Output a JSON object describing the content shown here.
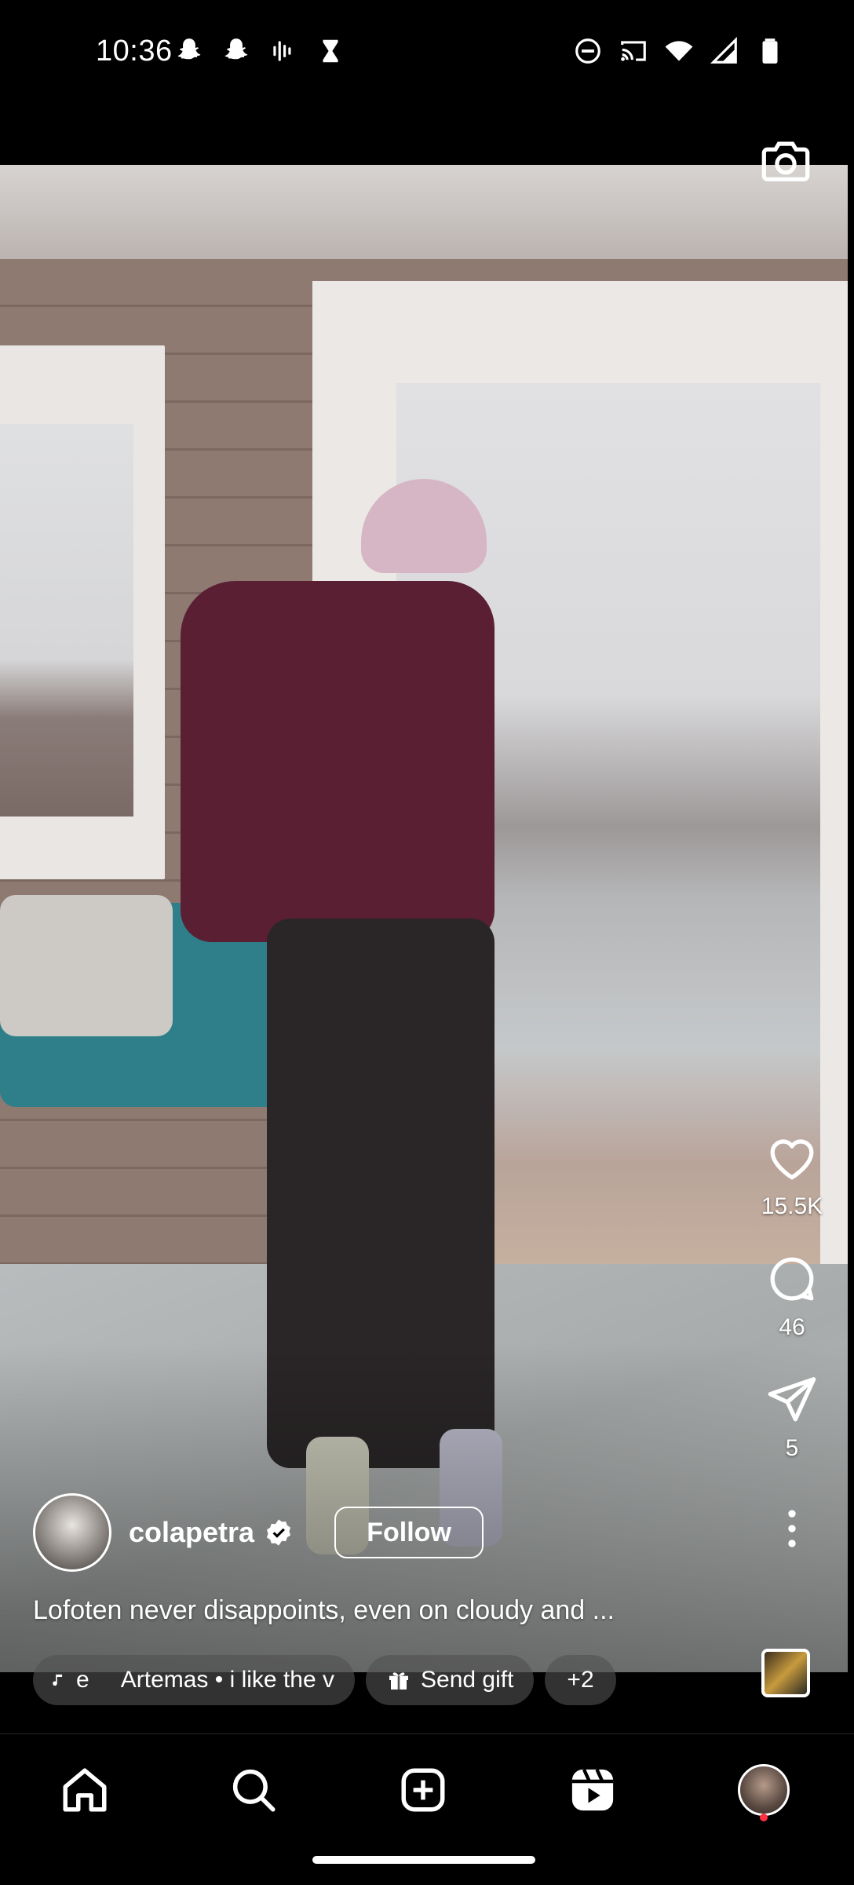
{
  "status_bar": {
    "time": "10:36",
    "left_icons": [
      "snapchat-icon",
      "snapchat-icon",
      "voice-recorder-icon",
      "hourglass-icon"
    ],
    "right_icons": [
      "do-not-disturb-icon",
      "cast-icon",
      "wifi-icon",
      "cellular-signal-icon",
      "battery-icon"
    ]
  },
  "reel": {
    "camera_icon": "camera-icon",
    "author": {
      "username": "colapetra",
      "verified": true,
      "follow_label": "Follow"
    },
    "caption": "Lofoten never disappoints, even on cloudy and ...",
    "chips": {
      "music_prefix": "e",
      "music_text": "Artemas • i like the v",
      "gift_label": "Send gift",
      "more_label": "+2"
    },
    "actions": {
      "like_count": "15.5K",
      "comment_count": "46",
      "share_count": "5"
    }
  },
  "bottom_nav": {
    "items": [
      "home-icon",
      "search-icon",
      "create-icon",
      "reels-icon",
      "profile-avatar"
    ],
    "active": "reels",
    "notification_dot_color": "#ff3040"
  }
}
